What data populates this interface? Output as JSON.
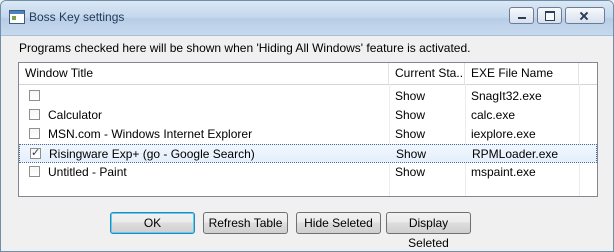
{
  "window": {
    "title": "Boss Key settings"
  },
  "instruction": "Programs checked here will be shown when 'Hiding All Windows' feature is activated.",
  "table": {
    "columns": [
      "Window Title",
      "Current Sta...",
      "EXE File Name"
    ],
    "rows": [
      {
        "checked": false,
        "title": "",
        "status": "Show",
        "exe": "SnagIt32.exe"
      },
      {
        "checked": false,
        "title": "Calculator",
        "status": "Show",
        "exe": "calc.exe"
      },
      {
        "checked": false,
        "title": "MSN.com - Windows Internet Explorer",
        "status": "Show",
        "exe": "iexplore.exe"
      },
      {
        "checked": true,
        "title": "Risingware Exp+  (go - Google Search)",
        "status": "Show",
        "exe": "RPMLoader.exe"
      },
      {
        "checked": false,
        "title": "Untitled - Paint",
        "status": "Show",
        "exe": "mspaint.exe"
      }
    ]
  },
  "buttons": {
    "ok": "OK",
    "refresh": "Refresh Table",
    "hide": "Hide Seleted",
    "display": "Display Seleted"
  }
}
